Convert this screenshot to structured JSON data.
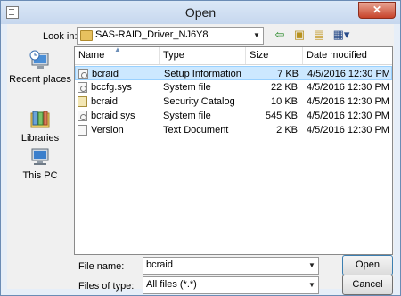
{
  "window": {
    "title": "Open",
    "close_glyph": "✕"
  },
  "lookin": {
    "label": "Look in:",
    "value": "SAS-RAID_Driver_NJ6Y8"
  },
  "toolbar": {
    "icons": [
      "back-icon",
      "up-folder-icon",
      "new-folder-icon",
      "view-menu-icon"
    ]
  },
  "places": [
    {
      "label": "Recent places",
      "icon": "recent-places-icon"
    },
    {
      "label": "Libraries",
      "icon": "libraries-icon"
    },
    {
      "label": "This PC",
      "icon": "this-pc-icon"
    }
  ],
  "table": {
    "columns": [
      "Name",
      "Type",
      "Size",
      "Date modified"
    ],
    "rows": [
      {
        "name": "bcraid",
        "type": "Setup Information",
        "size": "7 KB",
        "date": "4/5/2016 12:30 PM",
        "selected": true,
        "icon": "setup-info-icon"
      },
      {
        "name": "bccfg.sys",
        "type": "System file",
        "size": "22 KB",
        "date": "4/5/2016 12:30 PM",
        "selected": false,
        "icon": "system-file-icon"
      },
      {
        "name": "bcraid",
        "type": "Security Catalog",
        "size": "10 KB",
        "date": "4/5/2016 12:30 PM",
        "selected": false,
        "icon": "security-catalog-icon"
      },
      {
        "name": "bcraid.sys",
        "type": "System file",
        "size": "545 KB",
        "date": "4/5/2016 12:30 PM",
        "selected": false,
        "icon": "system-file-icon"
      },
      {
        "name": "Version",
        "type": "Text Document",
        "size": "2 KB",
        "date": "4/5/2016 12:30 PM",
        "selected": false,
        "icon": "text-document-icon"
      }
    ]
  },
  "filename": {
    "label": "File name:",
    "value": "bcraid"
  },
  "filetype": {
    "label": "Files of type:",
    "value": "All files (*.*)"
  },
  "buttons": {
    "open": "Open",
    "cancel": "Cancel"
  },
  "colors": {
    "selection": "#cce8ff",
    "titlebar": "#c6d7ee",
    "close": "#c7432a"
  }
}
